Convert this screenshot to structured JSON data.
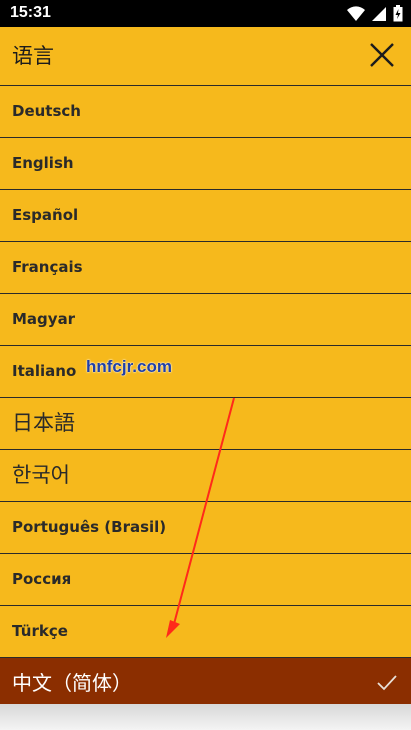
{
  "status_bar": {
    "time": "15:31"
  },
  "header": {
    "title": "语言"
  },
  "languages": [
    {
      "label": "Deutsch"
    },
    {
      "label": "English"
    },
    {
      "label": "Español"
    },
    {
      "label": "Français"
    },
    {
      "label": "Magyar"
    },
    {
      "label": "Italiano"
    },
    {
      "label": "日本語"
    },
    {
      "label": "한국어"
    },
    {
      "label": "Português (Brasil)"
    },
    {
      "label": "Россия"
    },
    {
      "label": "Türkçe"
    },
    {
      "label": "中文（简体）",
      "selected": true
    }
  ],
  "watermark": "hnfcjr.com",
  "colors": {
    "background": "#f6b91c",
    "selected": "#8b2e00",
    "annotation_arrow": "#ff2a1a"
  },
  "icons": [
    "wifi-icon",
    "signal-icon",
    "battery-icon",
    "close-icon",
    "checkmark-icon"
  ]
}
